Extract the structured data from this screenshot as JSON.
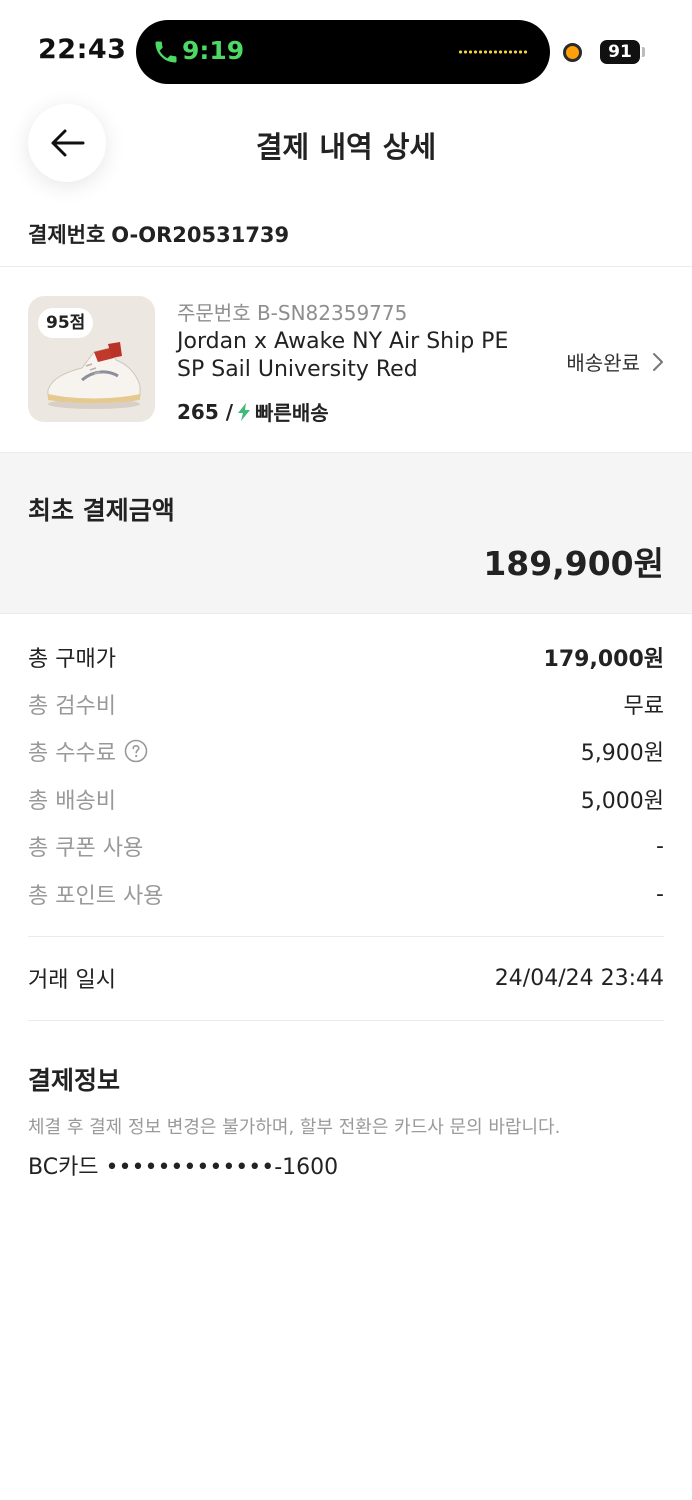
{
  "status_bar": {
    "time": "22:43",
    "call_time": "9:19",
    "battery": "91"
  },
  "header": {
    "title": "결제 내역 상세"
  },
  "payment": {
    "label": "결제번호",
    "number": "O-OR20531739"
  },
  "product": {
    "score_badge": "95점",
    "order_number": "주문번호 B-SN82359775",
    "name": "Jordan x Awake NY Air Ship PE SP Sail University Red",
    "size": "265 /",
    "shipping_type": "빠른배송",
    "status": "배송완료"
  },
  "total": {
    "label": "최초 결제금액",
    "amount": "189,900원"
  },
  "fees": [
    {
      "label": "총 구매가",
      "value": "179,000원"
    },
    {
      "label": "총 검수비",
      "value": "무료"
    },
    {
      "label": "총 수수료",
      "value": "5,900원"
    },
    {
      "label": "총 배송비",
      "value": "5,000원"
    },
    {
      "label": "총 쿠폰 사용",
      "value": "-"
    },
    {
      "label": "총 포인트 사용",
      "value": "-"
    }
  ],
  "transaction": {
    "label": "거래 일시",
    "value": "24/04/24 23:44"
  },
  "payment_info": {
    "title": "결제정보",
    "note": "체결 후 결제 정보 변경은 불가하며, 할부 전환은 카드사 문의 바랍니다.",
    "card": "BC카드 •••••••••••••-1600"
  },
  "colors": {
    "accent_green": "#41b979",
    "text_primary": "#222222",
    "text_muted": "#999999",
    "summary_bg": "#f5f5f5"
  }
}
